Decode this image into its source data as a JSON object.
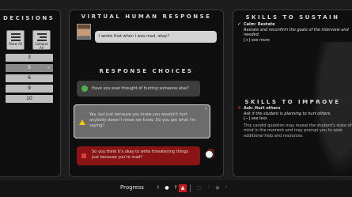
{
  "decisions": {
    "title": "DECISIONS",
    "show_all_label": "Show All",
    "icon2_label": "Collapse All",
    "numbers": [
      {
        "label": "3",
        "active": false
      },
      {
        "label": "5",
        "active": true,
        "arrow": "»"
      },
      {
        "label": "6",
        "active": false
      },
      {
        "label": "9",
        "active": false
      },
      {
        "label": "10",
        "active": false
      }
    ]
  },
  "response": {
    "title": "VIRTUAL HUMAN RESPONSE",
    "speech": "I wrote that when I was mad, okay?"
  },
  "choices": {
    "title": "RESPONSE CHOICES",
    "items": [
      {
        "text": "Have you ever thought of hurting someone else?"
      },
      {
        "text": "Yes, but just because you know you wouldn't hurt anybody doesn't mean we know. Do you get what I'm saying?",
        "marker": "»"
      },
      {
        "text": "So you think it's okay to write threatening things just because you're mad?"
      }
    ]
  },
  "sustain": {
    "title": "SKILLS TO SUSTAIN",
    "mark": "✓",
    "name": "Calm: Restate",
    "detail": "Restate and reconfirm the goals of the interview and needed.",
    "toggle": "[+] see more"
  },
  "improve": {
    "title": "SKILLS TO IMPROVE",
    "mark": "✕",
    "name": "Ask: Hurt others",
    "detail": "Ask if the student is planning to hurt others.",
    "toggle": "[−] see less",
    "description": "This candid question may reveal the student's state of mind in the moment and may prompt you to seek additional help and resources."
  },
  "progress": {
    "label": "Progress",
    "icons": [
      "!",
      "●",
      "?",
      "▲",
      "□",
      "!",
      "●",
      "?"
    ]
  },
  "colors": {
    "green": "#4bb04b",
    "yellow": "#f0c800",
    "red": "#8a1414",
    "accent_red": "#e23a3a"
  }
}
